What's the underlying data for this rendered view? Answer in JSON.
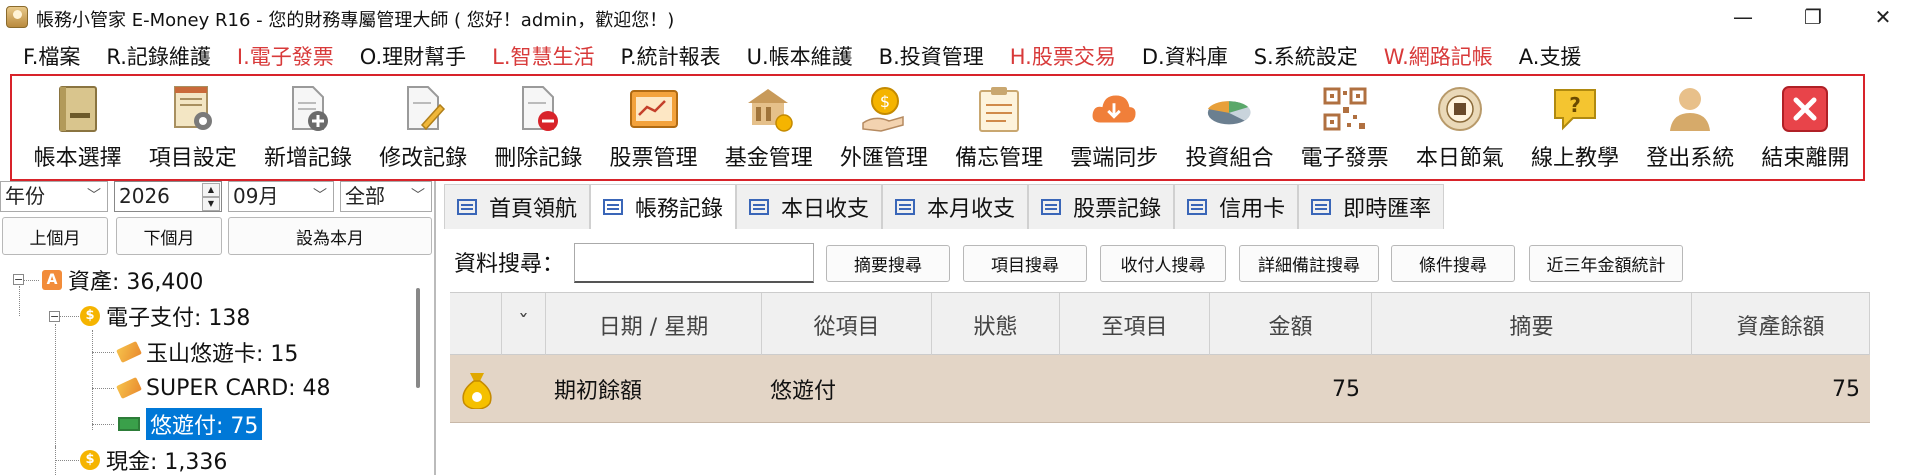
{
  "window": {
    "title": "帳務小管家 E-Money R16 - 您的財務專屬管理大師 ( 您好！admin，歡迎您！)",
    "minimize": "—",
    "maximize": "❐",
    "close": "✕"
  },
  "menu": [
    {
      "label": "F.檔案",
      "highlight": false
    },
    {
      "label": "R.記錄維護",
      "highlight": false
    },
    {
      "label": "I.電子發票",
      "highlight": true
    },
    {
      "label": "O.理財幫手",
      "highlight": false
    },
    {
      "label": "L.智慧生活",
      "highlight": true
    },
    {
      "label": "P.統計報表",
      "highlight": false
    },
    {
      "label": "U.帳本維護",
      "highlight": false
    },
    {
      "label": "B.投資管理",
      "highlight": false
    },
    {
      "label": "H.股票交易",
      "highlight": true
    },
    {
      "label": "D.資料庫",
      "highlight": false
    },
    {
      "label": "S.系統設定",
      "highlight": false
    },
    {
      "label": "W.網路記帳",
      "highlight": true
    },
    {
      "label": "A.支援",
      "highlight": false
    }
  ],
  "toolbar": [
    {
      "label": "帳本選擇",
      "icon": "ledger-book-icon"
    },
    {
      "label": "項目設定",
      "icon": "item-settings-icon"
    },
    {
      "label": "新增記錄",
      "icon": "add-record-icon"
    },
    {
      "label": "修改記錄",
      "icon": "edit-record-icon"
    },
    {
      "label": "刪除記錄",
      "icon": "delete-record-icon"
    },
    {
      "label": "股票管理",
      "icon": "stock-icon"
    },
    {
      "label": "基金管理",
      "icon": "fund-icon"
    },
    {
      "label": "外匯管理",
      "icon": "forex-icon"
    },
    {
      "label": "備忘管理",
      "icon": "memo-icon"
    },
    {
      "label": "雲端同步",
      "icon": "cloud-sync-icon"
    },
    {
      "label": "投資組合",
      "icon": "portfolio-icon"
    },
    {
      "label": "電子發票",
      "icon": "qr-code-icon"
    },
    {
      "label": "本日節氣",
      "icon": "solar-term-icon"
    },
    {
      "label": "線上教學",
      "icon": "help-icon"
    },
    {
      "label": "登出系統",
      "icon": "logout-icon"
    },
    {
      "label": "結束離開",
      "icon": "exit-icon"
    }
  ],
  "filters": {
    "period_type": "年份",
    "year": "2026",
    "month": "09月",
    "scope": "全部",
    "prev_month": "上個月",
    "next_month": "下個月",
    "set_current": "設為本月"
  },
  "tree": {
    "assets": "資產: 36,400",
    "epay": "電子支付: 138",
    "epay_children": [
      "玉山悠遊卡: 15",
      "SUPER CARD: 48",
      "悠遊付: 75"
    ],
    "cash": "現金: 1,336",
    "asset_badge": "A",
    "coin_badge": "$"
  },
  "tabs": [
    {
      "label": "首頁領航",
      "active": false
    },
    {
      "label": "帳務記錄",
      "active": true
    },
    {
      "label": "本日收支",
      "active": false
    },
    {
      "label": "本月收支",
      "active": false
    },
    {
      "label": "股票記錄",
      "active": false
    },
    {
      "label": "信用卡",
      "active": false
    },
    {
      "label": "即時匯率",
      "active": false
    }
  ],
  "search": {
    "label": "資料搜尋：",
    "value": "",
    "buttons": [
      "摘要搜尋",
      "項目搜尋",
      "收付人搜尋",
      "詳細備註搜尋",
      "條件搜尋",
      "近三年金額統計"
    ]
  },
  "grid": {
    "sort_glyph": "ˇ",
    "headers": [
      "日期 / 星期",
      "從項目",
      "狀態",
      "至項目",
      "金額",
      "摘要",
      "資產餘額"
    ],
    "rows": [
      {
        "date": "期初餘額",
        "from": "悠遊付",
        "status": "",
        "to": "",
        "amount": "75",
        "memo": "",
        "balance": "75"
      }
    ]
  },
  "colors": {
    "accent_red": "#d8232a",
    "menu_highlight": "#d83a3a",
    "selection": "#0078d7",
    "row_bg": "#e3d5c6"
  }
}
